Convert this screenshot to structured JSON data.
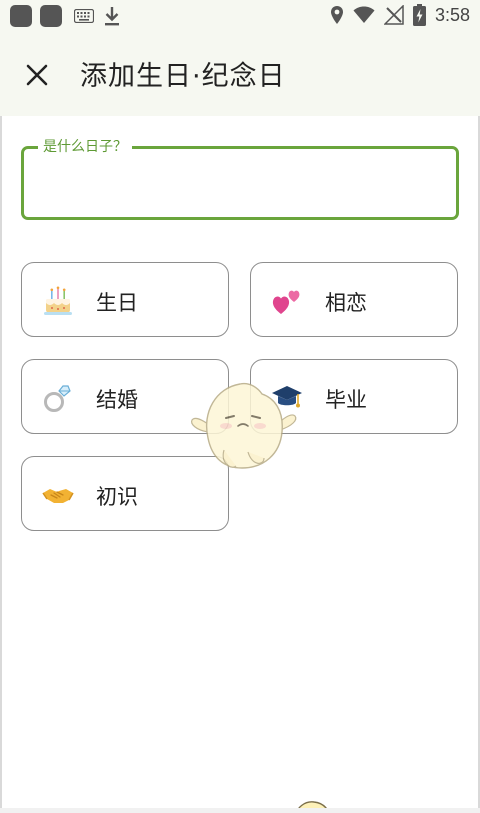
{
  "status_bar": {
    "time": "3:58",
    "icons": [
      "app-icon",
      "app-icon",
      "keyboard-icon",
      "download-icon",
      "location-icon",
      "wifi-icon",
      "no-signal-icon",
      "battery-charging-icon"
    ]
  },
  "app_bar": {
    "close_icon": "close-icon",
    "title": "添加生日·纪念日"
  },
  "input": {
    "label": "是什么日子？",
    "value": ""
  },
  "options": [
    {
      "label": "生日",
      "icon": "cake-icon"
    },
    {
      "label": "相恋",
      "icon": "hearts-icon"
    },
    {
      "label": "结婚",
      "icon": "ring-icon"
    },
    {
      "label": "毕业",
      "icon": "graduation-cap-icon"
    },
    {
      "label": "初识",
      "icon": "handshake-icon"
    }
  ],
  "colors": {
    "accent": "#6aa53c",
    "header_bg": "#f6f8f1",
    "card_border": "#8e8e8e",
    "text": "#222222"
  }
}
